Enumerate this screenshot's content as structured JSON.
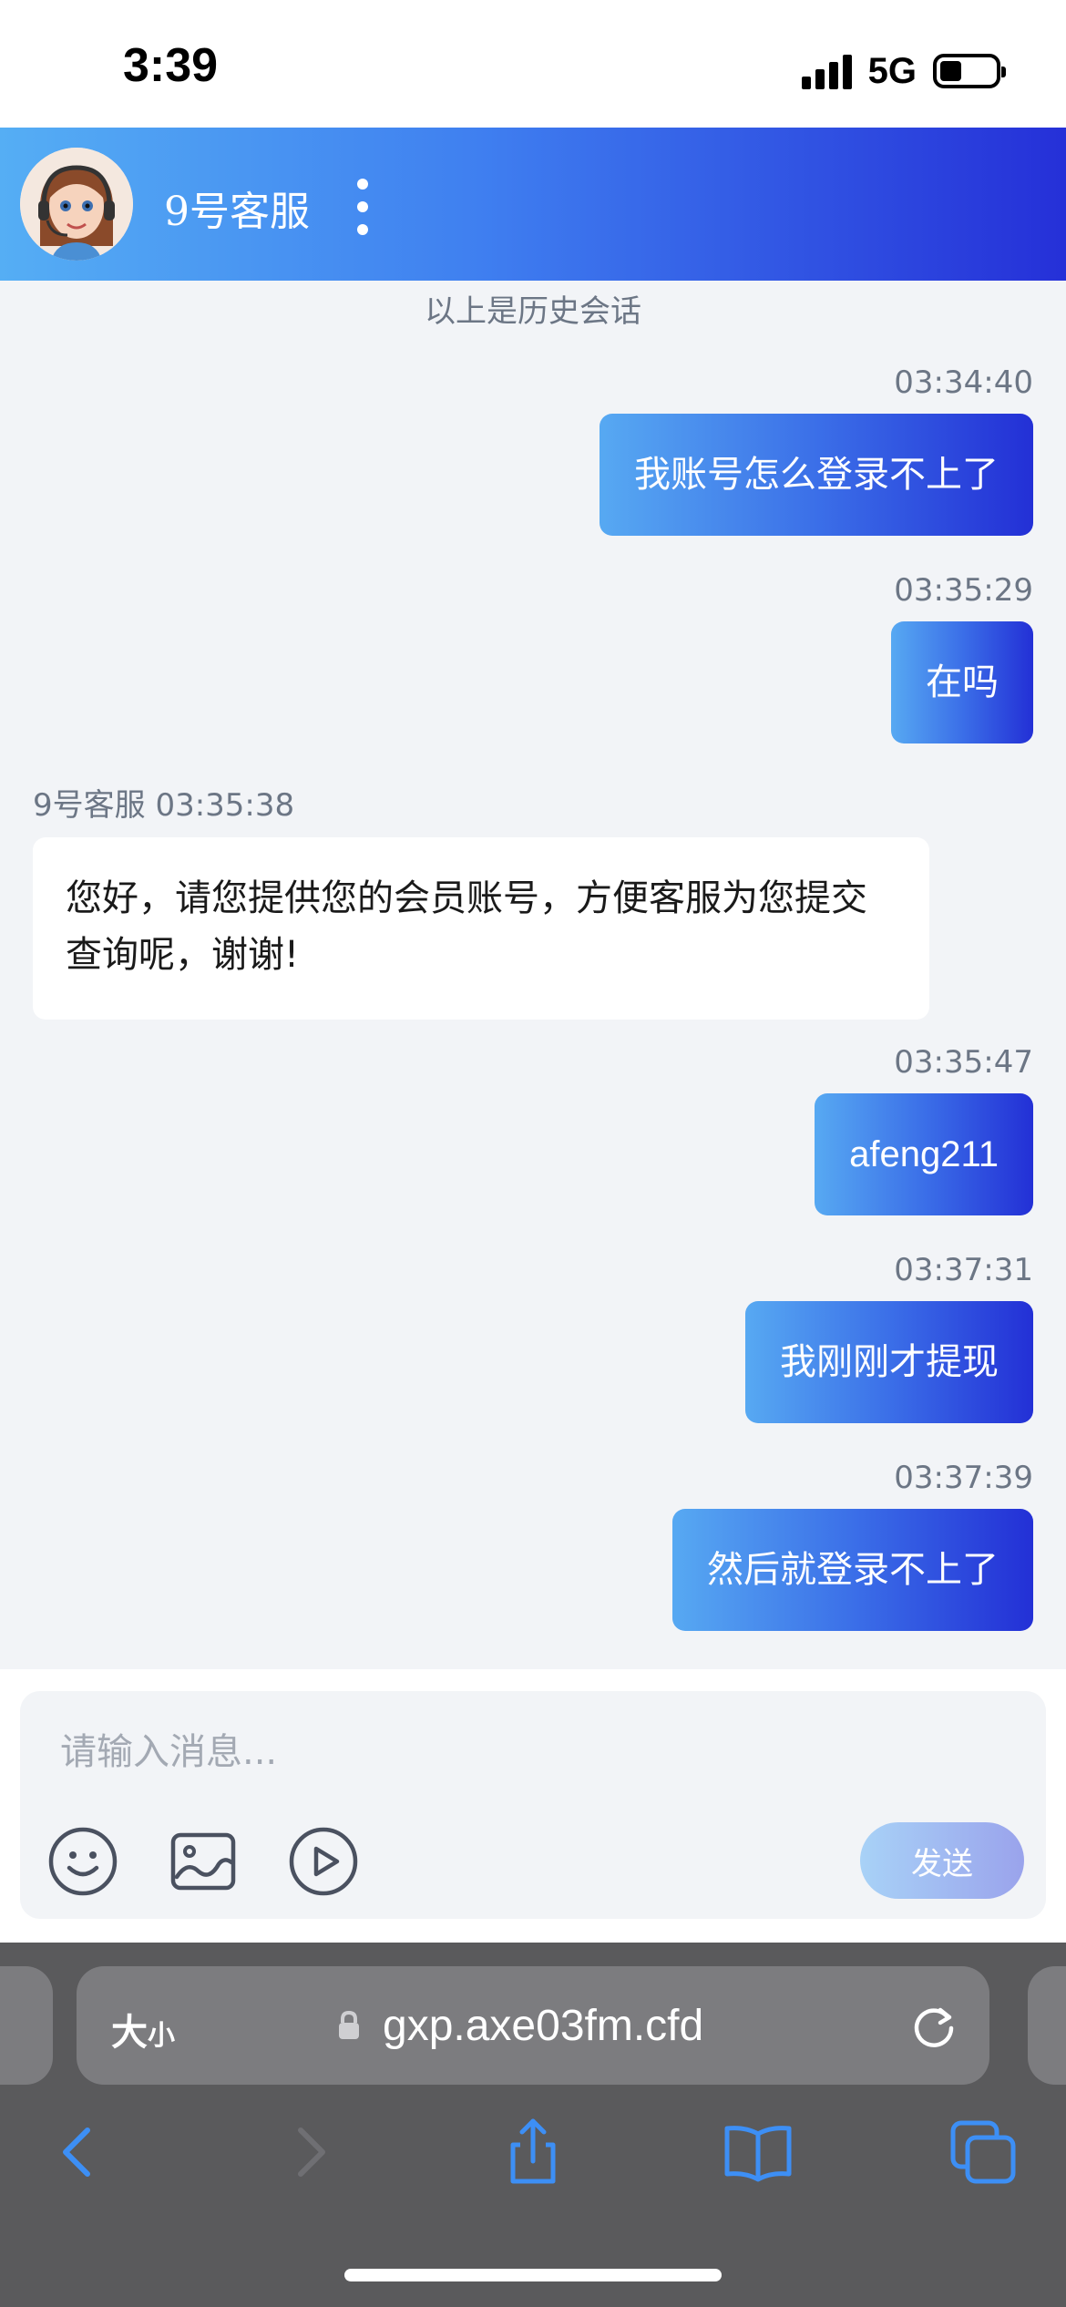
{
  "status_bar": {
    "time": "3:39",
    "network": "5G",
    "battery_percent": 40
  },
  "header": {
    "agent_name": "9号客服"
  },
  "chat": {
    "history_note": "以上是历史会话",
    "messages": [
      {
        "direction": "out",
        "time": "03:34:40",
        "text": "我账号怎么登录不上了"
      },
      {
        "direction": "out",
        "time": "03:35:29",
        "text": "在吗"
      },
      {
        "direction": "in",
        "sender_time": "9号客服 03:35:38",
        "text": "您好，请您提供您的会员账号，方便客服为您提交查询呢，谢谢!"
      },
      {
        "direction": "out",
        "time": "03:35:47",
        "text": "afeng211"
      },
      {
        "direction": "out",
        "time": "03:37:31",
        "text": "我刚刚才提现"
      },
      {
        "direction": "out",
        "time": "03:37:39",
        "text": "然后就登录不上了"
      }
    ]
  },
  "input": {
    "placeholder": "请输入消息...",
    "value": "",
    "tools": [
      "emoji-icon",
      "image-icon",
      "video-icon"
    ],
    "send_label": "发送"
  },
  "browser": {
    "text_size_label": "大",
    "text_size_small": "小",
    "url": "gxp.axe03fm.cfd",
    "toolbar_icons": [
      "back-icon",
      "forward-icon",
      "share-icon",
      "bookmarks-icon",
      "tabs-icon"
    ]
  },
  "colors": {
    "header_gradient_start": "#55aef4",
    "header_gradient_end": "#2530d8",
    "outgoing_bubble_start": "#57a9f2",
    "outgoing_bubble_end": "#2330d6",
    "chat_background": "#f2f4f7",
    "browser_background": "#5a5a5c"
  }
}
